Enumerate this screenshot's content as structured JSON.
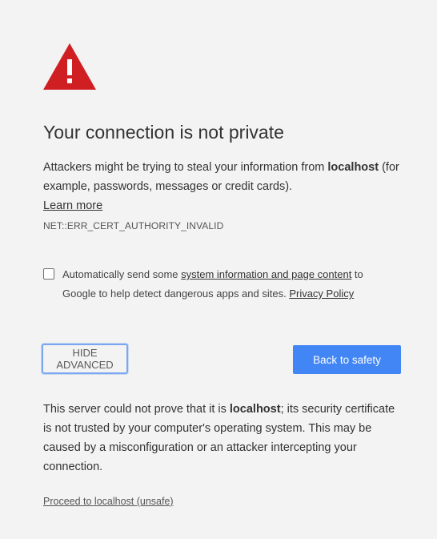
{
  "icon": {
    "name": "warning-triangle-icon",
    "color": "#d01f22"
  },
  "heading": "Your connection is not private",
  "main_message": {
    "line_before_host": "Attackers might be trying to steal your information from ",
    "host": "localhost",
    "line_after_host": " (for example, passwords, messages or credit cards).",
    "learn_more": "Learn more"
  },
  "error_code": "NET::ERR_CERT_AUTHORITY_INVALID",
  "reporting": {
    "checked": false,
    "text_before_link": "Automatically send some ",
    "link_text": "system information and page content",
    "text_after_link": " to Google to help detect dangerous apps and sites. ",
    "privacy_link": "Privacy Policy"
  },
  "buttons": {
    "hide_advanced": "HIDE ADVANCED",
    "back_to_safety": "Back to safety",
    "primary_color": "#4285f4"
  },
  "details": {
    "text_before_host": "This server could not prove that it is ",
    "host": "localhost",
    "text_after_host": "; its security certificate is not trusted by your computer's operating system. This may be caused by a misconfiguration or an attacker intercepting your connection."
  },
  "proceed_link": "Proceed to localhost (unsafe)"
}
